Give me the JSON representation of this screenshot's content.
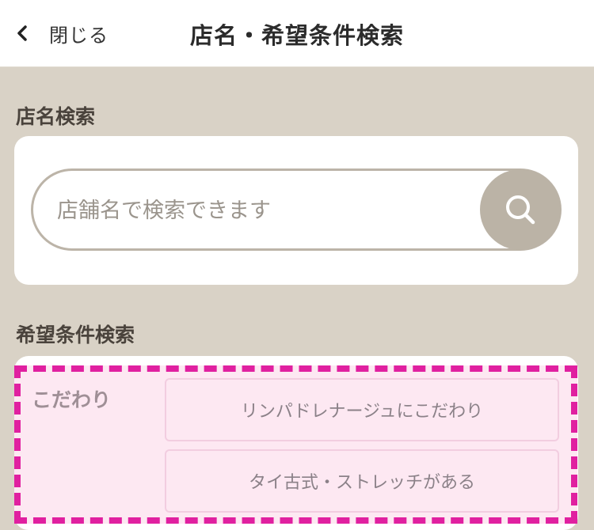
{
  "header": {
    "back_label": "閉じる",
    "title": "店名・希望条件検索"
  },
  "store_search": {
    "label": "店名検索",
    "placeholder": "店舗名で検索できます",
    "value": ""
  },
  "condition_search": {
    "label": "希望条件検索",
    "category": "こだわり",
    "options": [
      "リンパドレナージュにこだわり",
      "タイ古式・ストレッチがある"
    ]
  },
  "colors": {
    "background": "#d9d2c6",
    "search_button": "#bbb3a6",
    "highlight_border": "#e020a0",
    "chip_background": "#fde8f2"
  }
}
